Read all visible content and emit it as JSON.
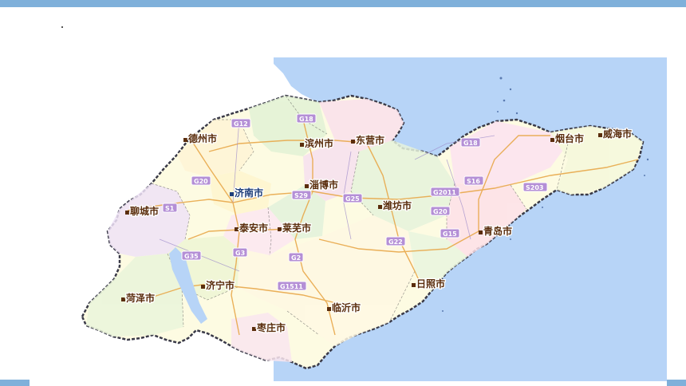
{
  "colors": {
    "sea": "#b7d4f7",
    "land_border": "#3a3a48",
    "road_main": "#e8a84a",
    "highway_label": "#b48fd6",
    "city_text": "#5a2d0c",
    "frame_accent": "#7fb0da"
  },
  "cities": [
    {
      "name": "德州市"
    },
    {
      "name": "滨州市"
    },
    {
      "name": "东营市"
    },
    {
      "name": "烟台市"
    },
    {
      "name": "威海市"
    },
    {
      "name": "济南市"
    },
    {
      "name": "淄博市"
    },
    {
      "name": "聊城市"
    },
    {
      "name": "潍坊市"
    },
    {
      "name": "泰安市"
    },
    {
      "name": "莱芜市"
    },
    {
      "name": "青岛市"
    },
    {
      "name": "济宁市"
    },
    {
      "name": "日照市"
    },
    {
      "name": "菏泽市"
    },
    {
      "name": "临沂市"
    },
    {
      "name": "枣庄市"
    }
  ],
  "highways": [
    "G12",
    "G18",
    "G18",
    "G20",
    "S1",
    "S29",
    "G25",
    "G2011",
    "S16",
    "S203",
    "G20",
    "G15",
    "G22",
    "G35",
    "G3",
    "G2",
    "G1511"
  ]
}
